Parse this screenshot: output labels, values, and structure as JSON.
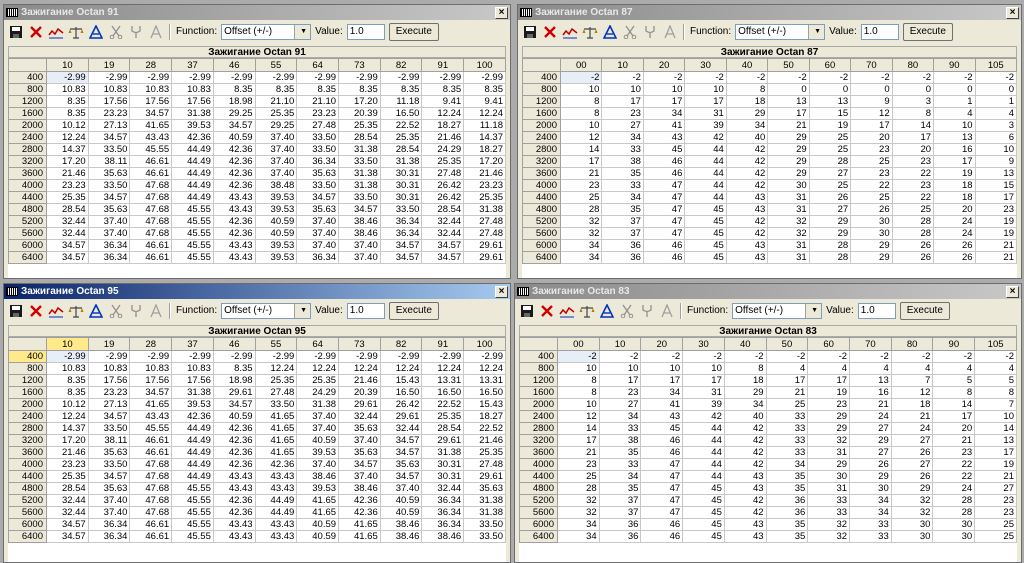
{
  "toolbar": {
    "function_label": "Function:",
    "function_value": "Offset (+/-)",
    "value_label": "Value:",
    "value_input": "1.0",
    "execute": "Execute"
  },
  "windows": [
    {
      "title": "Зажигание Octan 91",
      "table_title": "Зажигание Octan 91",
      "active": false,
      "cols": [
        "10",
        "19",
        "28",
        "37",
        "46",
        "55",
        "64",
        "73",
        "82",
        "91",
        "100"
      ],
      "rows": [
        {
          "rpm": "400",
          "v": [
            "-2.99",
            "-2.99",
            "-2.99",
            "-2.99",
            "-2.99",
            "-2.99",
            "-2.99",
            "-2.99",
            "-2.99",
            "-2.99",
            "-2.99"
          ]
        },
        {
          "rpm": "800",
          "v": [
            "10.83",
            "10.83",
            "10.83",
            "10.83",
            "8.35",
            "8.35",
            "8.35",
            "8.35",
            "8.35",
            "8.35",
            "8.35"
          ]
        },
        {
          "rpm": "1200",
          "v": [
            "8.35",
            "17.56",
            "17.56",
            "17.56",
            "18.98",
            "21.10",
            "21.10",
            "17.20",
            "11.18",
            "9.41",
            "9.41"
          ]
        },
        {
          "rpm": "1600",
          "v": [
            "8.35",
            "23.23",
            "34.57",
            "31.38",
            "29.25",
            "25.35",
            "23.23",
            "20.39",
            "16.50",
            "12.24",
            "12.24"
          ]
        },
        {
          "rpm": "2000",
          "v": [
            "10.12",
            "27.13",
            "41.65",
            "39.53",
            "34.57",
            "29.25",
            "27.48",
            "25.35",
            "22.52",
            "18.27",
            "11.18"
          ]
        },
        {
          "rpm": "2400",
          "v": [
            "12.24",
            "34.57",
            "43.43",
            "42.36",
            "40.59",
            "37.40",
            "33.50",
            "28.54",
            "25.35",
            "21.46",
            "14.37"
          ]
        },
        {
          "rpm": "2800",
          "v": [
            "14.37",
            "33.50",
            "45.55",
            "44.49",
            "42.36",
            "37.40",
            "33.50",
            "31.38",
            "28.54",
            "24.29",
            "18.27"
          ]
        },
        {
          "rpm": "3200",
          "v": [
            "17.20",
            "38.11",
            "46.61",
            "44.49",
            "42.36",
            "37.40",
            "36.34",
            "33.50",
            "31.38",
            "25.35",
            "17.20"
          ]
        },
        {
          "rpm": "3600",
          "v": [
            "21.46",
            "35.63",
            "46.61",
            "44.49",
            "42.36",
            "37.40",
            "35.63",
            "31.38",
            "30.31",
            "27.48",
            "21.46"
          ]
        },
        {
          "rpm": "4000",
          "v": [
            "23.23",
            "33.50",
            "47.68",
            "44.49",
            "42.36",
            "38.48",
            "33.50",
            "31.38",
            "30.31",
            "26.42",
            "23.23"
          ]
        },
        {
          "rpm": "4400",
          "v": [
            "25.35",
            "34.57",
            "47.68",
            "44.49",
            "43.43",
            "39.53",
            "34.57",
            "33.50",
            "30.31",
            "26.42",
            "25.35"
          ]
        },
        {
          "rpm": "4800",
          "v": [
            "28.54",
            "35.63",
            "47.68",
            "45.55",
            "43.43",
            "39.53",
            "35.63",
            "34.57",
            "33.50",
            "28.54",
            "31.38"
          ]
        },
        {
          "rpm": "5200",
          "v": [
            "32.44",
            "37.40",
            "47.68",
            "45.55",
            "42.36",
            "40.59",
            "37.40",
            "38.46",
            "36.34",
            "32.44",
            "27.48"
          ]
        },
        {
          "rpm": "5600",
          "v": [
            "32.44",
            "37.40",
            "47.68",
            "45.55",
            "42.36",
            "40.59",
            "37.40",
            "38.46",
            "36.34",
            "32.44",
            "27.48"
          ]
        },
        {
          "rpm": "6000",
          "v": [
            "34.57",
            "36.34",
            "46.61",
            "45.55",
            "43.43",
            "39.53",
            "37.40",
            "37.40",
            "34.57",
            "34.57",
            "29.61"
          ]
        },
        {
          "rpm": "6400",
          "v": [
            "34.57",
            "36.34",
            "46.61",
            "45.55",
            "43.43",
            "39.53",
            "36.34",
            "37.40",
            "34.57",
            "34.57",
            "29.61"
          ]
        }
      ]
    },
    {
      "title": "Зажигание Octan 87",
      "table_title": "Зажигание Octan 87",
      "active": false,
      "cols": [
        "00",
        "10",
        "20",
        "30",
        "40",
        "50",
        "60",
        "70",
        "80",
        "90",
        "105"
      ],
      "rows": [
        {
          "rpm": "400",
          "v": [
            "-2",
            "-2",
            "-2",
            "-2",
            "-2",
            "-2",
            "-2",
            "-2",
            "-2",
            "-2",
            "-2"
          ]
        },
        {
          "rpm": "800",
          "v": [
            "10",
            "10",
            "10",
            "10",
            "8",
            "0",
            "0",
            "0",
            "0",
            "0",
            "0"
          ]
        },
        {
          "rpm": "1200",
          "v": [
            "8",
            "17",
            "17",
            "17",
            "18",
            "13",
            "13",
            "9",
            "3",
            "1",
            "1"
          ]
        },
        {
          "rpm": "1600",
          "v": [
            "8",
            "23",
            "34",
            "31",
            "29",
            "17",
            "15",
            "12",
            "8",
            "4",
            "4"
          ]
        },
        {
          "rpm": "2000",
          "v": [
            "10",
            "27",
            "41",
            "39",
            "34",
            "21",
            "19",
            "17",
            "14",
            "10",
            "3"
          ]
        },
        {
          "rpm": "2400",
          "v": [
            "12",
            "34",
            "43",
            "42",
            "40",
            "29",
            "25",
            "20",
            "17",
            "13",
            "6"
          ]
        },
        {
          "rpm": "2800",
          "v": [
            "14",
            "33",
            "45",
            "44",
            "42",
            "29",
            "25",
            "23",
            "20",
            "16",
            "10"
          ]
        },
        {
          "rpm": "3200",
          "v": [
            "17",
            "38",
            "46",
            "44",
            "42",
            "29",
            "28",
            "25",
            "23",
            "17",
            "9"
          ]
        },
        {
          "rpm": "3600",
          "v": [
            "21",
            "35",
            "46",
            "44",
            "42",
            "29",
            "27",
            "23",
            "22",
            "19",
            "13"
          ]
        },
        {
          "rpm": "4000",
          "v": [
            "23",
            "33",
            "47",
            "44",
            "42",
            "30",
            "25",
            "22",
            "23",
            "18",
            "15"
          ]
        },
        {
          "rpm": "4400",
          "v": [
            "25",
            "34",
            "47",
            "44",
            "43",
            "31",
            "26",
            "25",
            "22",
            "18",
            "17"
          ]
        },
        {
          "rpm": "4800",
          "v": [
            "28",
            "35",
            "47",
            "45",
            "43",
            "31",
            "27",
            "26",
            "25",
            "20",
            "23"
          ]
        },
        {
          "rpm": "5200",
          "v": [
            "32",
            "37",
            "47",
            "45",
            "42",
            "32",
            "29",
            "30",
            "28",
            "24",
            "19"
          ]
        },
        {
          "rpm": "5600",
          "v": [
            "32",
            "37",
            "47",
            "45",
            "42",
            "32",
            "29",
            "30",
            "28",
            "24",
            "19"
          ]
        },
        {
          "rpm": "6000",
          "v": [
            "34",
            "36",
            "46",
            "45",
            "43",
            "31",
            "28",
            "29",
            "26",
            "26",
            "21"
          ]
        },
        {
          "rpm": "6400",
          "v": [
            "34",
            "36",
            "46",
            "45",
            "43",
            "31",
            "28",
            "29",
            "26",
            "26",
            "21"
          ]
        }
      ]
    },
    {
      "title": "Зажигание Octan 95",
      "table_title": "Зажигание Octan 95",
      "active": true,
      "cols": [
        "10",
        "19",
        "28",
        "37",
        "46",
        "55",
        "64",
        "73",
        "82",
        "91",
        "100"
      ],
      "rows": [
        {
          "rpm": "400",
          "v": [
            "-2.99",
            "-2.99",
            "-2.99",
            "-2.99",
            "-2.99",
            "-2.99",
            "-2.99",
            "-2.99",
            "-2.99",
            "-2.99",
            "-2.99"
          ]
        },
        {
          "rpm": "800",
          "v": [
            "10.83",
            "10.83",
            "10.83",
            "10.83",
            "8.35",
            "12.24",
            "12.24",
            "12.24",
            "12.24",
            "12.24",
            "12.24"
          ]
        },
        {
          "rpm": "1200",
          "v": [
            "8.35",
            "17.56",
            "17.56",
            "17.56",
            "18.98",
            "25.35",
            "25.35",
            "21.46",
            "15.43",
            "13.31",
            "13.31"
          ]
        },
        {
          "rpm": "1600",
          "v": [
            "8.35",
            "23.23",
            "34.57",
            "31.38",
            "29.61",
            "27.48",
            "24.29",
            "20.39",
            "16.50",
            "16.50",
            "16.50"
          ]
        },
        {
          "rpm": "2000",
          "v": [
            "10.12",
            "27.13",
            "41.65",
            "39.53",
            "34.57",
            "33.50",
            "31.38",
            "29.61",
            "26.42",
            "22.52",
            "15.43"
          ]
        },
        {
          "rpm": "2400",
          "v": [
            "12.24",
            "34.57",
            "43.43",
            "42.36",
            "40.59",
            "41.65",
            "37.40",
            "32.44",
            "29.61",
            "25.35",
            "18.27"
          ]
        },
        {
          "rpm": "2800",
          "v": [
            "14.37",
            "33.50",
            "45.55",
            "44.49",
            "42.36",
            "41.65",
            "37.40",
            "35.63",
            "32.44",
            "28.54",
            "22.52"
          ]
        },
        {
          "rpm": "3200",
          "v": [
            "17.20",
            "38.11",
            "46.61",
            "44.49",
            "42.36",
            "41.65",
            "40.59",
            "37.40",
            "34.57",
            "29.61",
            "21.46"
          ]
        },
        {
          "rpm": "3600",
          "v": [
            "21.46",
            "35.63",
            "46.61",
            "44.49",
            "42.36",
            "41.65",
            "39.53",
            "35.63",
            "34.57",
            "31.38",
            "25.35"
          ]
        },
        {
          "rpm": "4000",
          "v": [
            "23.23",
            "33.50",
            "47.68",
            "44.49",
            "42.36",
            "42.36",
            "37.40",
            "34.57",
            "35.63",
            "30.31",
            "27.48"
          ]
        },
        {
          "rpm": "4400",
          "v": [
            "25.35",
            "34.57",
            "47.68",
            "44.49",
            "43.43",
            "43.43",
            "38.46",
            "37.40",
            "34.57",
            "30.31",
            "29.61"
          ]
        },
        {
          "rpm": "4800",
          "v": [
            "28.54",
            "35.63",
            "47.68",
            "45.55",
            "43.43",
            "43.43",
            "39.53",
            "38.46",
            "37.40",
            "32.44",
            "35.63"
          ]
        },
        {
          "rpm": "5200",
          "v": [
            "32.44",
            "37.40",
            "47.68",
            "45.55",
            "42.36",
            "44.49",
            "41.65",
            "42.36",
            "40.59",
            "36.34",
            "31.38"
          ]
        },
        {
          "rpm": "5600",
          "v": [
            "32.44",
            "37.40",
            "47.68",
            "45.55",
            "42.36",
            "44.49",
            "41.65",
            "42.36",
            "40.59",
            "36.34",
            "31.38"
          ]
        },
        {
          "rpm": "6000",
          "v": [
            "34.57",
            "36.34",
            "46.61",
            "45.55",
            "43.43",
            "43.43",
            "40.59",
            "41.65",
            "38.46",
            "36.34",
            "33.50"
          ]
        },
        {
          "rpm": "6400",
          "v": [
            "34.57",
            "36.34",
            "46.61",
            "45.55",
            "43.43",
            "43.43",
            "40.59",
            "41.65",
            "38.46",
            "38.46",
            "33.50"
          ]
        }
      ]
    },
    {
      "title": "Зажигание Octan 83",
      "table_title": "Зажигание Octan 83",
      "active": false,
      "cols": [
        "00",
        "10",
        "20",
        "30",
        "40",
        "50",
        "60",
        "70",
        "80",
        "90",
        "105"
      ],
      "rows": [
        {
          "rpm": "400",
          "v": [
            "-2",
            "-2",
            "-2",
            "-2",
            "-2",
            "-2",
            "-2",
            "-2",
            "-2",
            "-2",
            "-2"
          ]
        },
        {
          "rpm": "800",
          "v": [
            "10",
            "10",
            "10",
            "10",
            "8",
            "4",
            "4",
            "4",
            "4",
            "4",
            "4"
          ]
        },
        {
          "rpm": "1200",
          "v": [
            "8",
            "17",
            "17",
            "17",
            "18",
            "17",
            "17",
            "13",
            "7",
            "5",
            "5"
          ]
        },
        {
          "rpm": "1600",
          "v": [
            "8",
            "23",
            "34",
            "31",
            "29",
            "21",
            "19",
            "16",
            "12",
            "8",
            "8"
          ]
        },
        {
          "rpm": "2000",
          "v": [
            "10",
            "27",
            "41",
            "39",
            "34",
            "25",
            "23",
            "21",
            "18",
            "14",
            "7"
          ]
        },
        {
          "rpm": "2400",
          "v": [
            "12",
            "34",
            "43",
            "42",
            "40",
            "33",
            "29",
            "24",
            "21",
            "17",
            "10"
          ]
        },
        {
          "rpm": "2800",
          "v": [
            "14",
            "33",
            "45",
            "44",
            "42",
            "33",
            "29",
            "27",
            "24",
            "20",
            "14"
          ]
        },
        {
          "rpm": "3200",
          "v": [
            "17",
            "38",
            "46",
            "44",
            "42",
            "33",
            "32",
            "29",
            "27",
            "21",
            "13"
          ]
        },
        {
          "rpm": "3600",
          "v": [
            "21",
            "35",
            "46",
            "44",
            "42",
            "33",
            "31",
            "27",
            "26",
            "23",
            "17"
          ]
        },
        {
          "rpm": "4000",
          "v": [
            "23",
            "33",
            "47",
            "44",
            "42",
            "34",
            "29",
            "26",
            "27",
            "22",
            "19"
          ]
        },
        {
          "rpm": "4400",
          "v": [
            "25",
            "34",
            "47",
            "44",
            "43",
            "35",
            "30",
            "29",
            "26",
            "22",
            "21"
          ]
        },
        {
          "rpm": "4800",
          "v": [
            "28",
            "35",
            "47",
            "45",
            "43",
            "35",
            "31",
            "30",
            "29",
            "24",
            "27"
          ]
        },
        {
          "rpm": "5200",
          "v": [
            "32",
            "37",
            "47",
            "45",
            "42",
            "36",
            "33",
            "34",
            "32",
            "28",
            "23"
          ]
        },
        {
          "rpm": "5600",
          "v": [
            "32",
            "37",
            "47",
            "45",
            "42",
            "36",
            "33",
            "34",
            "32",
            "28",
            "23"
          ]
        },
        {
          "rpm": "6000",
          "v": [
            "34",
            "36",
            "46",
            "45",
            "43",
            "35",
            "32",
            "33",
            "30",
            "30",
            "25"
          ]
        },
        {
          "rpm": "6400",
          "v": [
            "34",
            "36",
            "46",
            "45",
            "43",
            "35",
            "32",
            "33",
            "30",
            "30",
            "25"
          ]
        }
      ]
    }
  ]
}
